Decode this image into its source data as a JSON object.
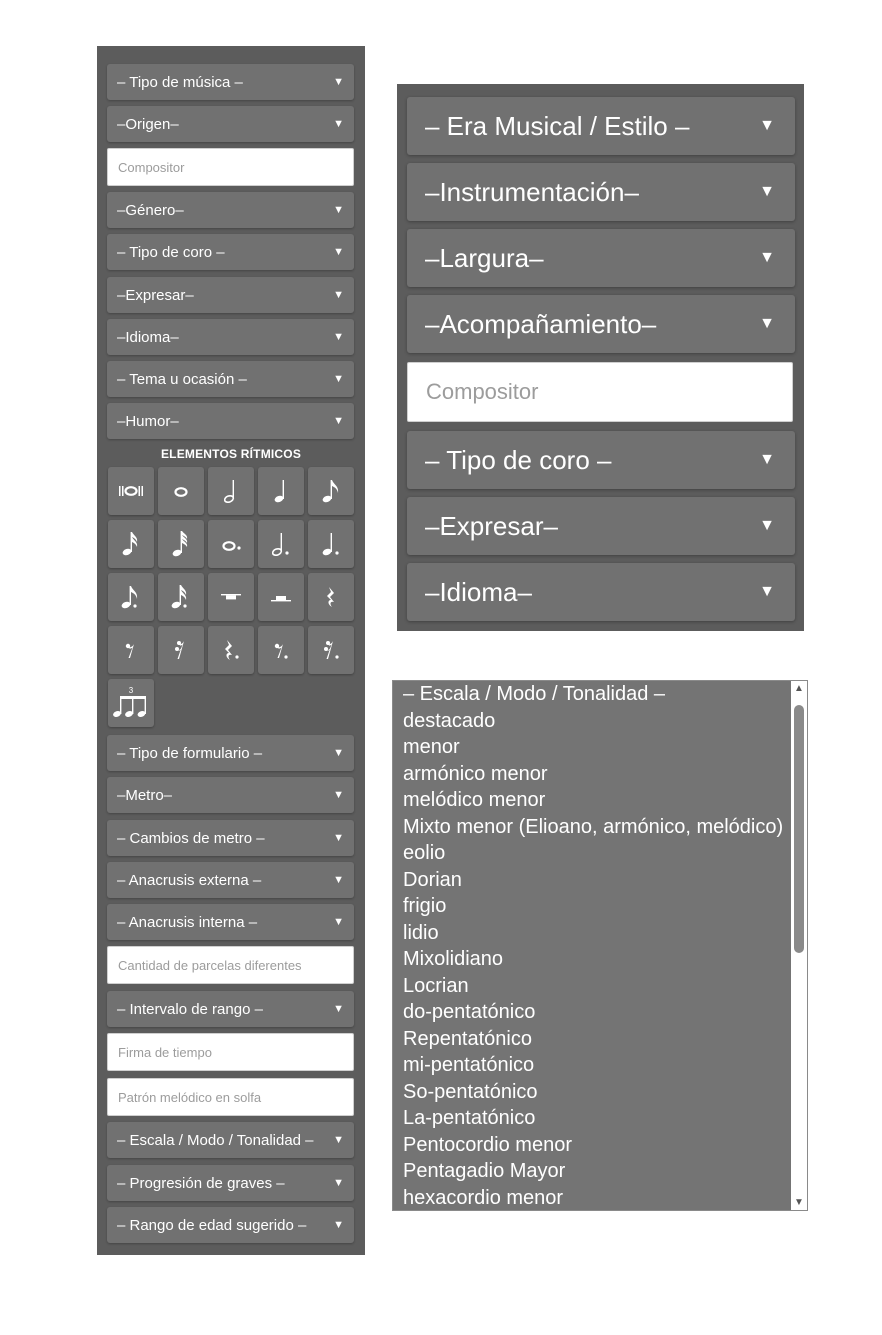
{
  "left_panel": {
    "selects_top": [
      {
        "label": "– Tipo de música –"
      },
      {
        "label": "–Origen–"
      }
    ],
    "composer_placeholder": "Compositor",
    "selects_mid": [
      {
        "label": "–Género–"
      },
      {
        "label": "– Tipo de coro –"
      },
      {
        "label": "–Expresar–"
      },
      {
        "label": "–Idioma–"
      },
      {
        "label": "– Tema u ocasión –"
      },
      {
        "label": "–Humor–"
      }
    ],
    "rhythm_title": "ELEMENTOS RÍTMICOS",
    "rhythm_tuplet_number": "3",
    "rhythm_buttons": [
      {
        "icon": "breve-note-icon"
      },
      {
        "icon": "whole-note-icon"
      },
      {
        "icon": "half-note-icon"
      },
      {
        "icon": "quarter-note-icon"
      },
      {
        "icon": "eighth-note-icon"
      },
      {
        "icon": "sixteenth-note-icon"
      },
      {
        "icon": "thirty-second-note-icon"
      },
      {
        "icon": "dotted-whole-note-icon"
      },
      {
        "icon": "dotted-half-note-icon"
      },
      {
        "icon": "dotted-quarter-note-icon"
      },
      {
        "icon": "dotted-eighth-note-icon"
      },
      {
        "icon": "dotted-sixteenth-note-icon"
      },
      {
        "icon": "whole-rest-icon"
      },
      {
        "icon": "half-rest-icon"
      },
      {
        "icon": "quarter-rest-icon"
      },
      {
        "icon": "eighth-rest-icon"
      },
      {
        "icon": "sixteenth-rest-icon"
      },
      {
        "icon": "dotted-quarter-rest-icon"
      },
      {
        "icon": "dotted-eighth-rest-icon"
      },
      {
        "icon": "dotted-sixteenth-rest-icon"
      },
      {
        "icon": "triplet-eighths-icon"
      }
    ],
    "selects_bottom_1": [
      {
        "label": "– Tipo de formulario –"
      },
      {
        "label": "–Metro–"
      },
      {
        "label": "– Cambios de metro –"
      },
      {
        "label": "– Anacrusis externa –"
      },
      {
        "label": "– Anacrusis interna –"
      }
    ],
    "parcel_count_placeholder": "Cantidad de parcelas diferentes",
    "range_interval_label": "– Intervalo de rango –",
    "time_signature_placeholder": "Firma de tiempo",
    "melodic_pattern_placeholder": "Patrón melódico en solfa",
    "selects_bottom_2": [
      {
        "label": "– Escala / Modo / Tonalidad –"
      },
      {
        "label": "– Progresión de graves –"
      },
      {
        "label": "– Rango de edad sugerido –"
      }
    ]
  },
  "right_panel": {
    "selects_top": [
      {
        "label": "– Era Musical / Estilo –"
      },
      {
        "label": "–Instrumentación–"
      },
      {
        "label": "–Largura–"
      },
      {
        "label": "–Acompañamiento–"
      }
    ],
    "composer_placeholder": "Compositor",
    "selects_bottom": [
      {
        "label": "– Tipo de coro –"
      },
      {
        "label": "–Expresar–"
      },
      {
        "label": "–Idioma–"
      }
    ]
  },
  "scale_list": {
    "options": [
      "– Escala / Modo / Tonalidad –",
      "destacado",
      "menor",
      "armónico menor",
      "melódico menor",
      "Mixto menor (Elioano, armónico, melódico)",
      "eolio",
      "Dorian",
      "frigio",
      "lidio",
      "Mixolidiano",
      "Locrian",
      "do-pentatónico",
      "Repentatónico",
      "mi-pentatónico",
      "So-pentatónico",
      "La-pentatónico",
      "Pentocordio menor",
      "Pentagadio Mayor",
      "hexacordio menor"
    ]
  },
  "arrow_glyph": "▼",
  "colors": {
    "panel_bg": "#5c5c5c",
    "select_bg": "#717171",
    "list_bg": "#747474",
    "text": "#ffffff",
    "placeholder": "#9c9c9c"
  }
}
